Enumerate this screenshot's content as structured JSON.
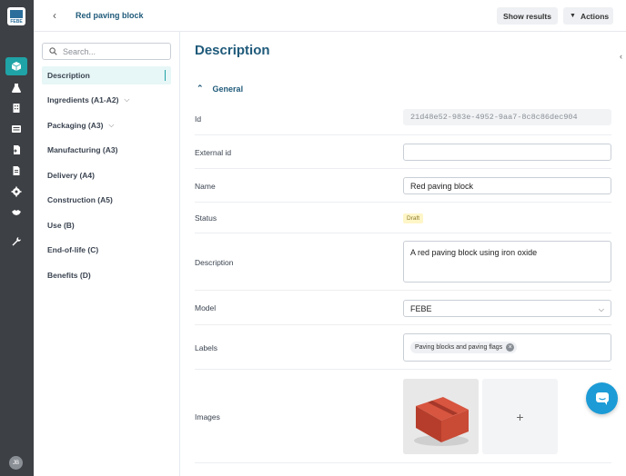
{
  "app": {
    "logo_text": "FEBE",
    "user_initials": "JB"
  },
  "rail": {
    "items": [
      {
        "icon": "box-icon",
        "active": true
      },
      {
        "icon": "flask-icon",
        "active": false
      },
      {
        "icon": "building-icon",
        "active": false
      },
      {
        "icon": "list-icon",
        "active": false
      },
      {
        "icon": "import-file-icon",
        "active": false
      },
      {
        "icon": "document-icon",
        "active": false
      },
      {
        "icon": "gear-icon",
        "active": false
      },
      {
        "icon": "handshake-icon",
        "active": false
      },
      {
        "icon": "wrench-icon",
        "active": false
      }
    ]
  },
  "topbar": {
    "title": "Red paving block",
    "show_results_label": "Show results",
    "actions_label": "Actions"
  },
  "leftnav": {
    "search_placeholder": "Search...",
    "items": [
      {
        "label": "Description",
        "active": true,
        "has_chevron": false
      },
      {
        "label": "Ingredients (A1-A2)",
        "active": false,
        "has_chevron": true
      },
      {
        "label": "Packaging (A3)",
        "active": false,
        "has_chevron": true
      },
      {
        "label": "Manufacturing (A3)",
        "active": false,
        "has_chevron": false
      },
      {
        "label": "Delivery (A4)",
        "active": false,
        "has_chevron": false
      },
      {
        "label": "Construction (A5)",
        "active": false,
        "has_chevron": false
      },
      {
        "label": "Use (B)",
        "active": false,
        "has_chevron": false
      },
      {
        "label": "End-of-life (C)",
        "active": false,
        "has_chevron": false
      },
      {
        "label": "Benefits (D)",
        "active": false,
        "has_chevron": false
      }
    ]
  },
  "main": {
    "heading": "Description",
    "section_title": "General",
    "fields": {
      "id_label": "Id",
      "id_value": "21d48e52-983e-4952-9aa7-8c8c86dec904",
      "external_id_label": "External id",
      "external_id_value": "",
      "name_label": "Name",
      "name_value": "Red paving block",
      "status_label": "Status",
      "status_value": "Draft",
      "description_label": "Description",
      "description_value": "A red paving block using iron oxide",
      "model_label": "Model",
      "model_value": "FEBE",
      "labels_label": "Labels",
      "labels_chip": "Paving blocks and paving flags",
      "images_label": "Images"
    }
  },
  "colors": {
    "accent": "#1fa3a6",
    "title": "#1f5a7a",
    "rail_bg": "#3d4045",
    "chat": "#1c9bd6"
  }
}
